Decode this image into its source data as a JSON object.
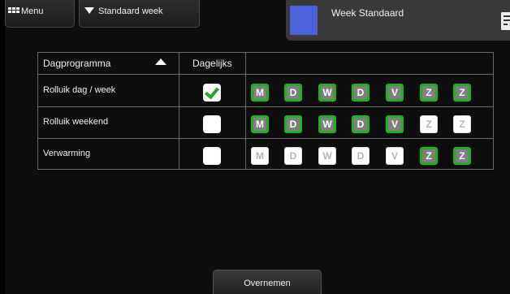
{
  "topbar": {
    "menu_label": "Menu",
    "week_select_label": "Standaard week"
  },
  "info_panel": {
    "title": "Week Standaard",
    "swatch_color": "#4b63d9"
  },
  "table": {
    "col_program": "Dagprogramma",
    "col_daily": "Dagelijks",
    "rows": [
      {
        "label": "Rolluik dag / week",
        "daily": true,
        "days": [
          {
            "letter": "M",
            "active": true
          },
          {
            "letter": "D",
            "active": true
          },
          {
            "letter": "W",
            "active": true
          },
          {
            "letter": "D",
            "active": true
          },
          {
            "letter": "V",
            "active": true
          },
          {
            "letter": "Z",
            "active": true
          },
          {
            "letter": "Z",
            "active": true
          }
        ]
      },
      {
        "label": "Rolluik weekend",
        "daily": false,
        "days": [
          {
            "letter": "M",
            "active": true
          },
          {
            "letter": "D",
            "active": true
          },
          {
            "letter": "W",
            "active": true
          },
          {
            "letter": "D",
            "active": true
          },
          {
            "letter": "V",
            "active": true
          },
          {
            "letter": "Z",
            "active": false
          },
          {
            "letter": "Z",
            "active": false
          }
        ]
      },
      {
        "label": "Verwarming",
        "daily": false,
        "days": [
          {
            "letter": "M",
            "active": false
          },
          {
            "letter": "D",
            "active": false
          },
          {
            "letter": "W",
            "active": false
          },
          {
            "letter": "D",
            "active": false
          },
          {
            "letter": "V",
            "active": false
          },
          {
            "letter": "Z",
            "active": true
          },
          {
            "letter": "Z",
            "active": true
          }
        ]
      }
    ]
  },
  "footer": {
    "apply_label": "Overnemen"
  },
  "colors": {
    "active_border": "#22b022",
    "active_fill": "#7f7f7f",
    "check": "#2e9e2e"
  }
}
